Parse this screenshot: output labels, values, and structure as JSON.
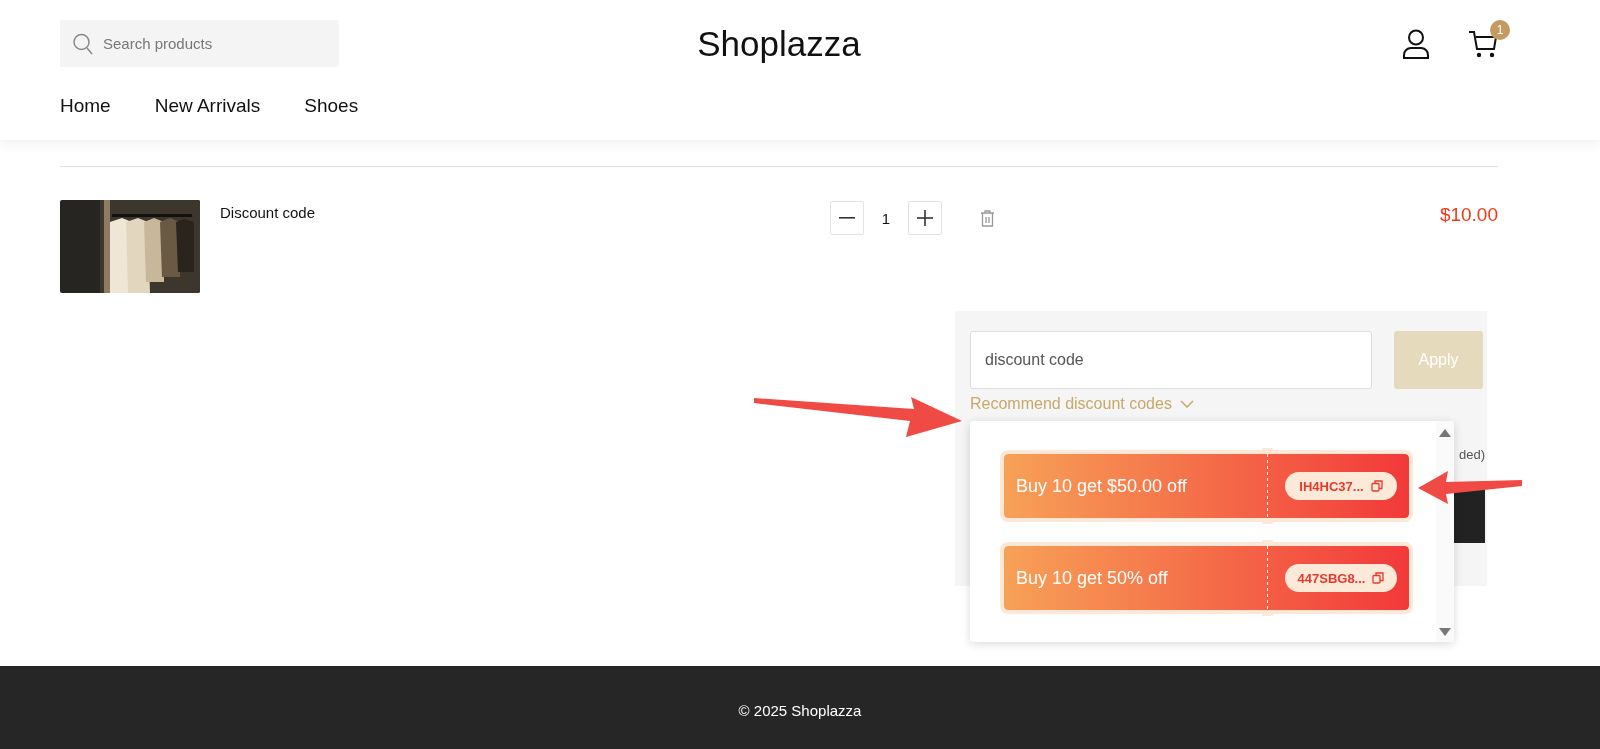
{
  "header": {
    "search": {
      "placeholder": "Search products"
    },
    "logo": "Shoplazza",
    "cart_count": "1"
  },
  "nav": [
    {
      "label": "Home"
    },
    {
      "label": "New Arrivals"
    },
    {
      "label": "Shoes"
    }
  ],
  "cart_item": {
    "title": "Discount code",
    "quantity": "1",
    "price": "$10.00"
  },
  "discount": {
    "input": {
      "placeholder": "discount code"
    },
    "apply": {
      "label": "Apply",
      "disabled": true
    },
    "recommend": {
      "label": "Recommend discount codes",
      "expanded": true
    },
    "coupons": [
      {
        "title": "Buy 10 get $50.00 off",
        "code": "IH4HC37..."
      },
      {
        "title": "Buy 10 get 50% off",
        "code": "447SBG8..."
      }
    ],
    "partial_text": "ded)"
  },
  "footer": {
    "text": "© 2025 Shoplazza"
  }
}
